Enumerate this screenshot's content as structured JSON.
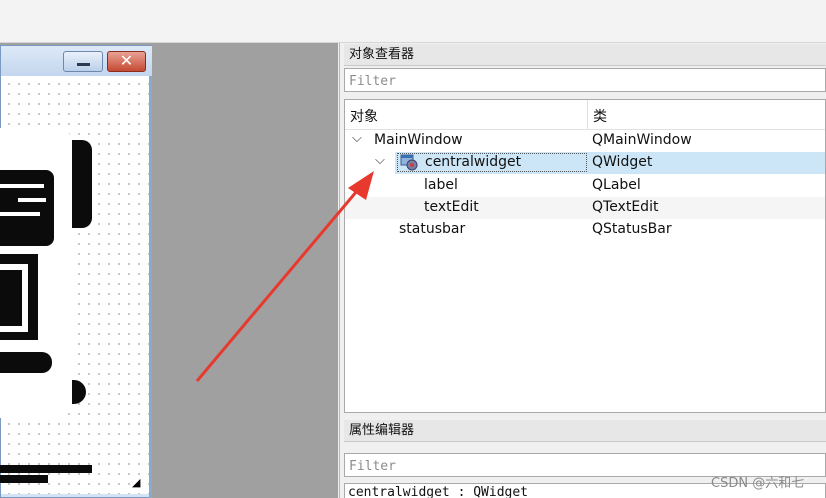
{
  "object_inspector": {
    "title": "对象查看器",
    "filter_placeholder": "Filter",
    "columns": {
      "object": "对象",
      "class": "类"
    },
    "rows": [
      {
        "name": "MainWindow",
        "class": "QMainWindow"
      },
      {
        "name": "centralwidget",
        "class": "QWidget"
      },
      {
        "name": "label",
        "class": "QLabel"
      },
      {
        "name": "textEdit",
        "class": "QTextEdit"
      },
      {
        "name": "statusbar",
        "class": "QStatusBar"
      }
    ]
  },
  "property_editor": {
    "title": "属性编辑器",
    "filter_placeholder": "Filter",
    "current_object": "centralwidget : QWidget"
  },
  "watermark": "CSDN @六和七",
  "icons": {
    "close": "close-icon",
    "minimize": "minimize-icon",
    "expand": "chevron-down-icon",
    "widget": "widget-icon"
  },
  "colors": {
    "selection": "#cde6f7",
    "annotation_arrow": "#e8392f",
    "canvas": "#a0a0a0"
  }
}
